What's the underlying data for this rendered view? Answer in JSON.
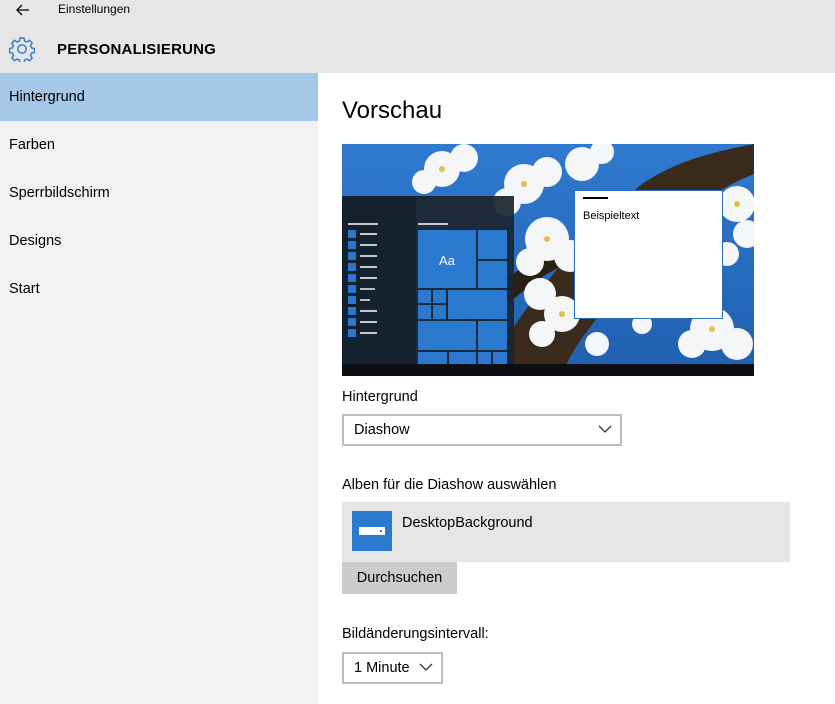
{
  "window": {
    "title": "Einstellungen"
  },
  "header": {
    "section_title": "PERSONALISIERUNG"
  },
  "sidebar": {
    "items": [
      {
        "label": "Hintergrund",
        "selected": true
      },
      {
        "label": "Farben",
        "selected": false
      },
      {
        "label": "Sperrbildschirm",
        "selected": false
      },
      {
        "label": "Designs",
        "selected": false
      },
      {
        "label": "Start",
        "selected": false
      }
    ]
  },
  "main": {
    "preview_title": "Vorschau",
    "preview": {
      "sample_text": "Beispieltext",
      "tile_label": "Aa"
    },
    "background": {
      "label": "Hintergrund",
      "value": "Diashow"
    },
    "albums": {
      "label": "Alben für die Diashow auswählen",
      "items": [
        "DesktopBackground"
      ]
    },
    "browse_button": "Durchsuchen",
    "interval": {
      "label": "Bildänderungsintervall:",
      "value": "1 Minute"
    }
  },
  "colors": {
    "accent": "#2a79cf",
    "selection": "#a6c8e8",
    "sky": "#2b6fc2",
    "titlebar": "#e6e6e6",
    "sidebar": "#f2f2f2"
  }
}
